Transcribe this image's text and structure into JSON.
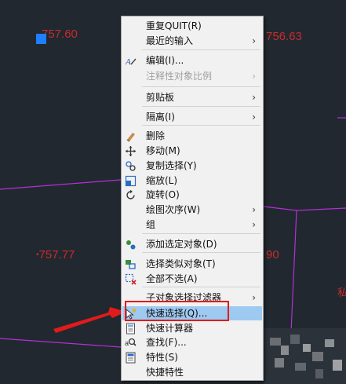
{
  "drawing": {
    "labels": {
      "top_left": "757.60",
      "top_right": "756.63",
      "mid_left": "757.77",
      "mid_right": "90",
      "right_edge": "私"
    },
    "colors": {
      "background": "#212830",
      "label": "#c72c2c",
      "line": "#b52fd6",
      "grip": "#1e7fff"
    }
  },
  "context_menu": {
    "items": [
      {
        "label": "重复QUIT(R)",
        "icon": "none",
        "submenu": false,
        "disabled": false
      },
      {
        "label": "最近的输入",
        "icon": "none",
        "submenu": true,
        "disabled": false
      },
      {
        "label": "编辑(I)...",
        "icon": "edit-text-icon",
        "submenu": false,
        "disabled": false
      },
      {
        "label": "注释性对象比例",
        "icon": "none",
        "submenu": true,
        "disabled": true
      },
      {
        "label": "剪贴板",
        "icon": "none",
        "submenu": true,
        "disabled": false
      },
      {
        "label": "隔离(I)",
        "icon": "none",
        "submenu": true,
        "disabled": false
      },
      {
        "label": "删除",
        "icon": "eraser-icon",
        "submenu": false,
        "disabled": false
      },
      {
        "label": "移动(M)",
        "icon": "move-icon",
        "submenu": false,
        "disabled": false
      },
      {
        "label": "复制选择(Y)",
        "icon": "copy-icon",
        "submenu": false,
        "disabled": false
      },
      {
        "label": "缩放(L)",
        "icon": "scale-icon",
        "submenu": false,
        "disabled": false
      },
      {
        "label": "旋转(O)",
        "icon": "rotate-icon",
        "submenu": false,
        "disabled": false
      },
      {
        "label": "绘图次序(W)",
        "icon": "none",
        "submenu": true,
        "disabled": false
      },
      {
        "label": "组",
        "icon": "none",
        "submenu": true,
        "disabled": false
      },
      {
        "label": "添加选定对象(D)",
        "icon": "add-selected-icon",
        "submenu": false,
        "disabled": false
      },
      {
        "label": "选择类似对象(T)",
        "icon": "select-similar-icon",
        "submenu": false,
        "disabled": false
      },
      {
        "label": "全部不选(A)",
        "icon": "deselect-all-icon",
        "submenu": false,
        "disabled": false
      },
      {
        "label": "子对象选择过滤器",
        "icon": "none",
        "submenu": true,
        "disabled": false
      },
      {
        "label": "快速选择(Q)...",
        "icon": "quick-select-icon",
        "submenu": false,
        "disabled": false,
        "selected": true
      },
      {
        "label": "快速计算器",
        "icon": "calculator-icon",
        "submenu": false,
        "disabled": false
      },
      {
        "label": "查找(F)...",
        "icon": "find-icon",
        "submenu": false,
        "disabled": false
      },
      {
        "label": "特性(S)",
        "icon": "properties-icon",
        "submenu": false,
        "disabled": false
      },
      {
        "label": "快捷特性",
        "icon": "none",
        "submenu": false,
        "disabled": false
      }
    ],
    "submenu_glyph": "›"
  },
  "annotation": {
    "highlight_color": "#e11b1b"
  }
}
